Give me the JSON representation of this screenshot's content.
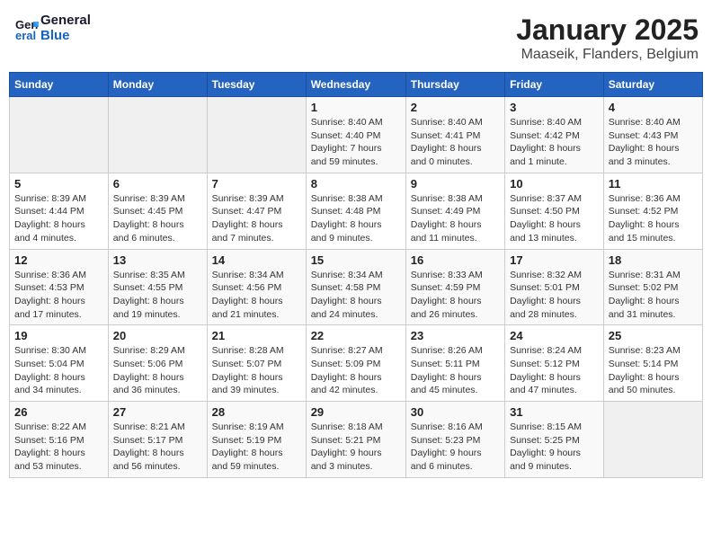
{
  "logo": {
    "line1": "General",
    "line2": "Blue"
  },
  "title": "January 2025",
  "subtitle": "Maaseik, Flanders, Belgium",
  "weekdays": [
    "Sunday",
    "Monday",
    "Tuesday",
    "Wednesday",
    "Thursday",
    "Friday",
    "Saturday"
  ],
  "weeks": [
    [
      {
        "day": "",
        "info": ""
      },
      {
        "day": "",
        "info": ""
      },
      {
        "day": "",
        "info": ""
      },
      {
        "day": "1",
        "info": "Sunrise: 8:40 AM\nSunset: 4:40 PM\nDaylight: 7 hours\nand 59 minutes."
      },
      {
        "day": "2",
        "info": "Sunrise: 8:40 AM\nSunset: 4:41 PM\nDaylight: 8 hours\nand 0 minutes."
      },
      {
        "day": "3",
        "info": "Sunrise: 8:40 AM\nSunset: 4:42 PM\nDaylight: 8 hours\nand 1 minute."
      },
      {
        "day": "4",
        "info": "Sunrise: 8:40 AM\nSunset: 4:43 PM\nDaylight: 8 hours\nand 3 minutes."
      }
    ],
    [
      {
        "day": "5",
        "info": "Sunrise: 8:39 AM\nSunset: 4:44 PM\nDaylight: 8 hours\nand 4 minutes."
      },
      {
        "day": "6",
        "info": "Sunrise: 8:39 AM\nSunset: 4:45 PM\nDaylight: 8 hours\nand 6 minutes."
      },
      {
        "day": "7",
        "info": "Sunrise: 8:39 AM\nSunset: 4:47 PM\nDaylight: 8 hours\nand 7 minutes."
      },
      {
        "day": "8",
        "info": "Sunrise: 8:38 AM\nSunset: 4:48 PM\nDaylight: 8 hours\nand 9 minutes."
      },
      {
        "day": "9",
        "info": "Sunrise: 8:38 AM\nSunset: 4:49 PM\nDaylight: 8 hours\nand 11 minutes."
      },
      {
        "day": "10",
        "info": "Sunrise: 8:37 AM\nSunset: 4:50 PM\nDaylight: 8 hours\nand 13 minutes."
      },
      {
        "day": "11",
        "info": "Sunrise: 8:36 AM\nSunset: 4:52 PM\nDaylight: 8 hours\nand 15 minutes."
      }
    ],
    [
      {
        "day": "12",
        "info": "Sunrise: 8:36 AM\nSunset: 4:53 PM\nDaylight: 8 hours\nand 17 minutes."
      },
      {
        "day": "13",
        "info": "Sunrise: 8:35 AM\nSunset: 4:55 PM\nDaylight: 8 hours\nand 19 minutes."
      },
      {
        "day": "14",
        "info": "Sunrise: 8:34 AM\nSunset: 4:56 PM\nDaylight: 8 hours\nand 21 minutes."
      },
      {
        "day": "15",
        "info": "Sunrise: 8:34 AM\nSunset: 4:58 PM\nDaylight: 8 hours\nand 24 minutes."
      },
      {
        "day": "16",
        "info": "Sunrise: 8:33 AM\nSunset: 4:59 PM\nDaylight: 8 hours\nand 26 minutes."
      },
      {
        "day": "17",
        "info": "Sunrise: 8:32 AM\nSunset: 5:01 PM\nDaylight: 8 hours\nand 28 minutes."
      },
      {
        "day": "18",
        "info": "Sunrise: 8:31 AM\nSunset: 5:02 PM\nDaylight: 8 hours\nand 31 minutes."
      }
    ],
    [
      {
        "day": "19",
        "info": "Sunrise: 8:30 AM\nSunset: 5:04 PM\nDaylight: 8 hours\nand 34 minutes."
      },
      {
        "day": "20",
        "info": "Sunrise: 8:29 AM\nSunset: 5:06 PM\nDaylight: 8 hours\nand 36 minutes."
      },
      {
        "day": "21",
        "info": "Sunrise: 8:28 AM\nSunset: 5:07 PM\nDaylight: 8 hours\nand 39 minutes."
      },
      {
        "day": "22",
        "info": "Sunrise: 8:27 AM\nSunset: 5:09 PM\nDaylight: 8 hours\nand 42 minutes."
      },
      {
        "day": "23",
        "info": "Sunrise: 8:26 AM\nSunset: 5:11 PM\nDaylight: 8 hours\nand 45 minutes."
      },
      {
        "day": "24",
        "info": "Sunrise: 8:24 AM\nSunset: 5:12 PM\nDaylight: 8 hours\nand 47 minutes."
      },
      {
        "day": "25",
        "info": "Sunrise: 8:23 AM\nSunset: 5:14 PM\nDaylight: 8 hours\nand 50 minutes."
      }
    ],
    [
      {
        "day": "26",
        "info": "Sunrise: 8:22 AM\nSunset: 5:16 PM\nDaylight: 8 hours\nand 53 minutes."
      },
      {
        "day": "27",
        "info": "Sunrise: 8:21 AM\nSunset: 5:17 PM\nDaylight: 8 hours\nand 56 minutes."
      },
      {
        "day": "28",
        "info": "Sunrise: 8:19 AM\nSunset: 5:19 PM\nDaylight: 8 hours\nand 59 minutes."
      },
      {
        "day": "29",
        "info": "Sunrise: 8:18 AM\nSunset: 5:21 PM\nDaylight: 9 hours\nand 3 minutes."
      },
      {
        "day": "30",
        "info": "Sunrise: 8:16 AM\nSunset: 5:23 PM\nDaylight: 9 hours\nand 6 minutes."
      },
      {
        "day": "31",
        "info": "Sunrise: 8:15 AM\nSunset: 5:25 PM\nDaylight: 9 hours\nand 9 minutes."
      },
      {
        "day": "",
        "info": ""
      }
    ]
  ]
}
